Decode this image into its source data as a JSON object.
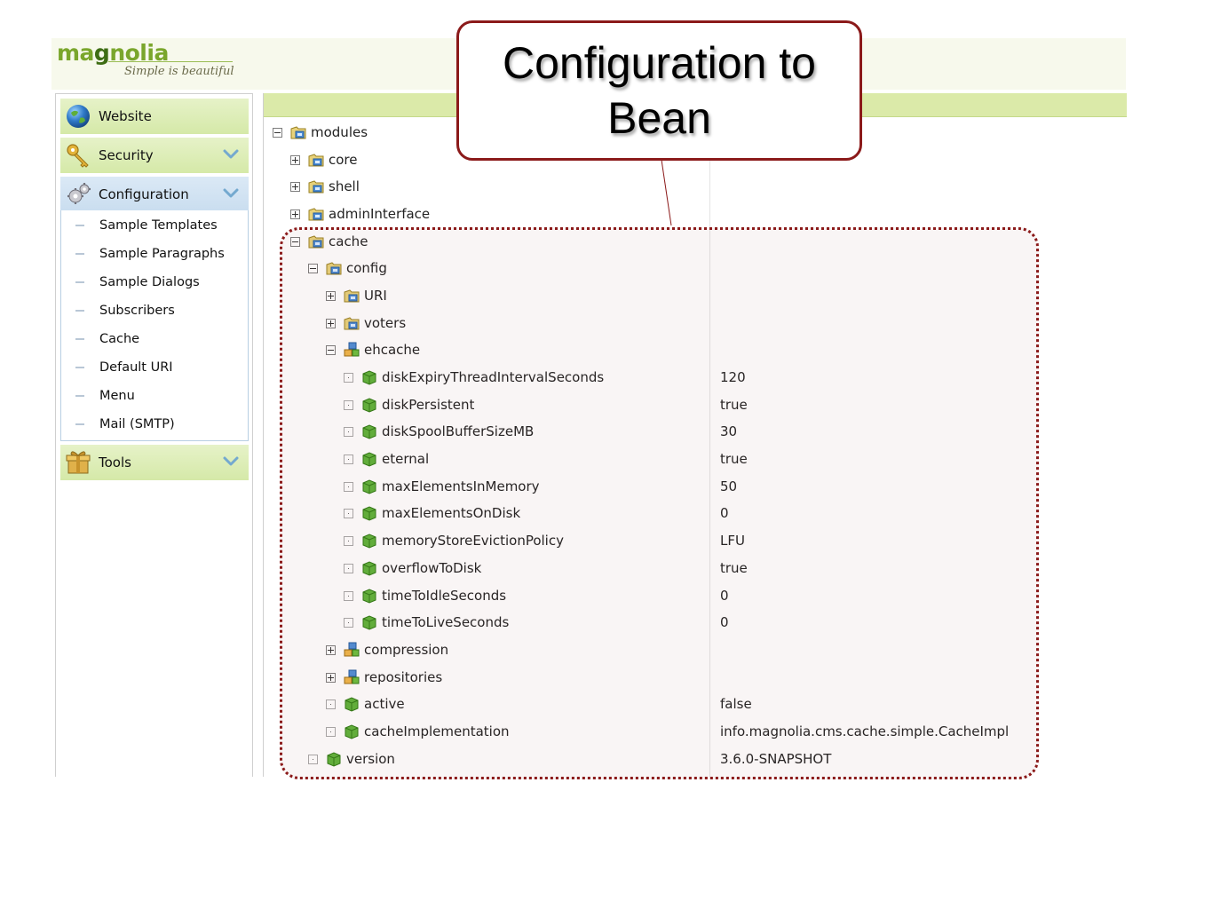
{
  "logo": {
    "wordmark_a": "ma",
    "wordmark_g": "g",
    "wordmark_b": "nolia",
    "tagline": "Simple is beautiful"
  },
  "sidebar": {
    "website": "Website",
    "security": "Security",
    "configuration": "Configuration",
    "tools": "Tools",
    "config_items": [
      "Sample Templates",
      "Sample Paragraphs",
      "Sample Dialogs",
      "Subscribers",
      "Cache",
      "Default URI",
      "Menu",
      "Mail (SMTP)"
    ]
  },
  "tree": {
    "modules": "modules",
    "core": "core",
    "shell": "shell",
    "adminInterface": "adminInterface",
    "cache": "cache",
    "config": "config",
    "URI": "URI",
    "voters": "voters",
    "ehcache": "ehcache",
    "properties": [
      {
        "name": "diskExpiryThreadIntervalSeconds",
        "value": "120"
      },
      {
        "name": "diskPersistent",
        "value": "true"
      },
      {
        "name": "diskSpoolBufferSizeMB",
        "value": "30"
      },
      {
        "name": "eternal",
        "value": "true"
      },
      {
        "name": "maxElementsInMemory",
        "value": "50"
      },
      {
        "name": "maxElementsOnDisk",
        "value": "0"
      },
      {
        "name": "memoryStoreEvictionPolicy",
        "value": "LFU"
      },
      {
        "name": "overflowToDisk",
        "value": "true"
      },
      {
        "name": "timeToIdleSeconds",
        "value": "0"
      },
      {
        "name": "timeToLiveSeconds",
        "value": "0"
      }
    ],
    "compression": "compression",
    "repositories": "repositories",
    "active": {
      "name": "active",
      "value": "false"
    },
    "cacheImplementation": {
      "name": "cacheImplementation",
      "value": "info.magnolia.cms.cache.simple.CacheImpl"
    },
    "version": {
      "name": "version",
      "value": "3.6.0-SNAPSHOT"
    }
  },
  "callout": {
    "text": "Configuration to Bean"
  },
  "colors": {
    "accent_green": "#7aa62c",
    "highlight_red": "#8b1a1a",
    "nav_green": "#d5e9a8",
    "nav_blue": "#c9ddef"
  },
  "icons": [
    "globe-icon",
    "keys-icon",
    "gears-icon",
    "gift-box-icon",
    "chevron-down-icon",
    "folder-icon",
    "content-node-icon",
    "node-data-icon",
    "expand-toggle-icon",
    "collapse-toggle-icon"
  ]
}
